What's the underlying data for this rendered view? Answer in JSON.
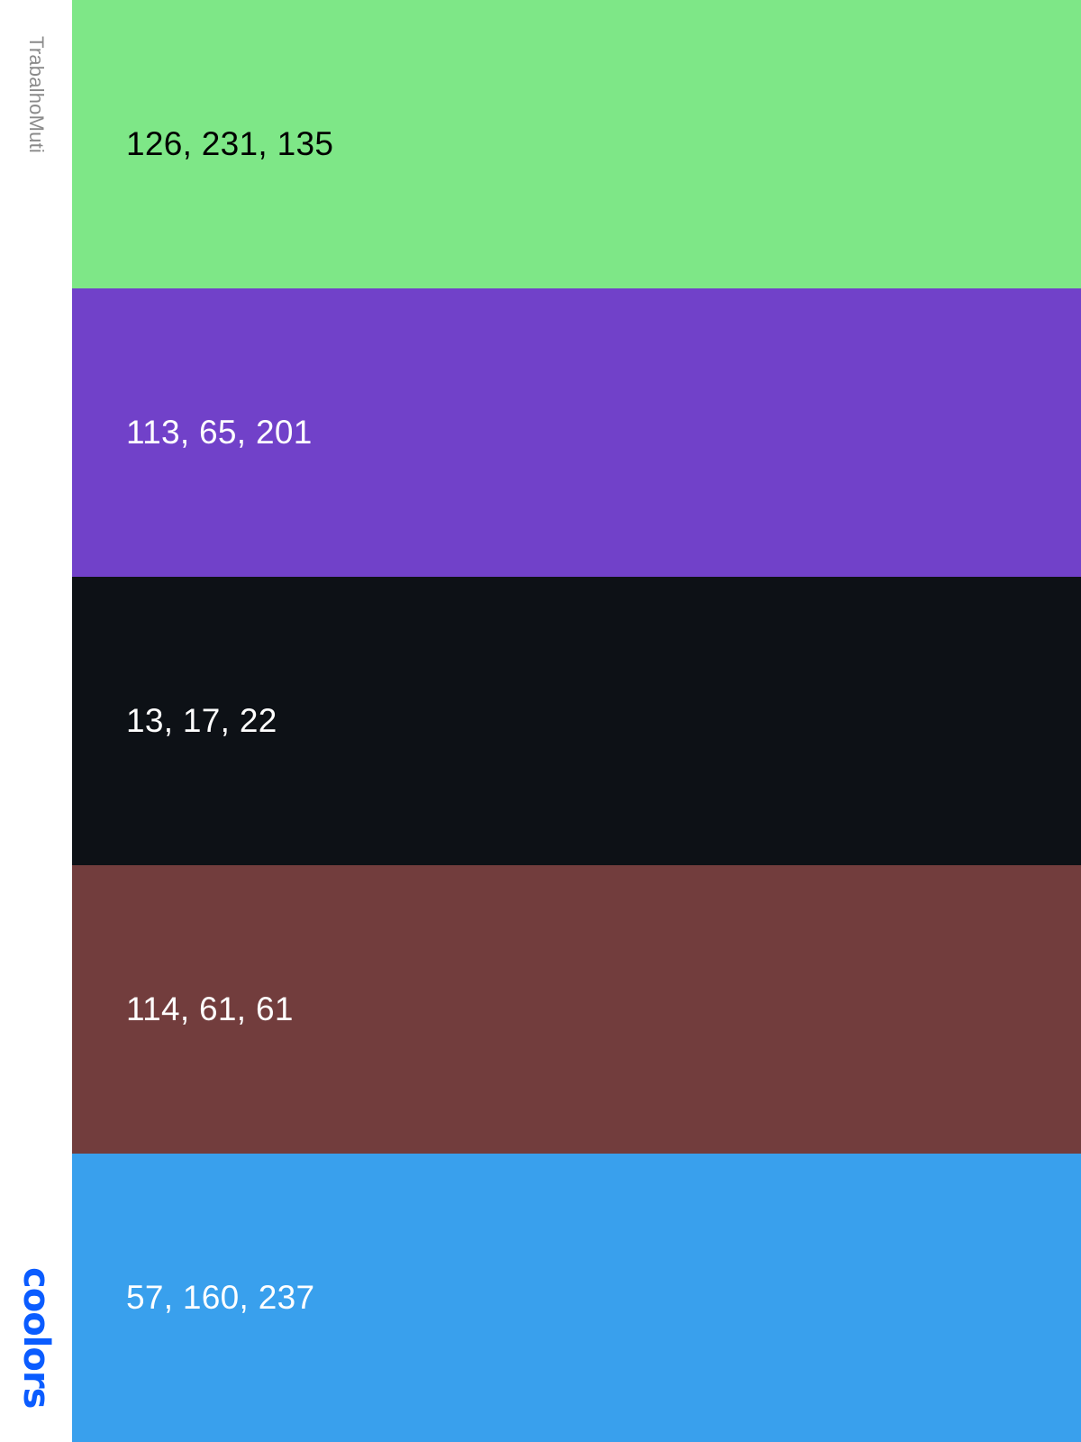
{
  "sidebar": {
    "palette_name": "TrabalhoMuti",
    "brand": "coolors",
    "brand_color": "#0a5cff"
  },
  "swatches": [
    {
      "label": "126, 231, 135",
      "color": "#7ee787",
      "text_color": "#000000"
    },
    {
      "label": "113, 65, 201",
      "color": "#7141c9",
      "text_color": "#ffffff"
    },
    {
      "label": "13, 17, 22",
      "color": "#0d1116",
      "text_color": "#ffffff"
    },
    {
      "label": "114, 61, 61",
      "color": "#723d3d",
      "text_color": "#ffffff"
    },
    {
      "label": "57, 160, 237",
      "color": "#39a0ed",
      "text_color": "#ffffff"
    }
  ]
}
